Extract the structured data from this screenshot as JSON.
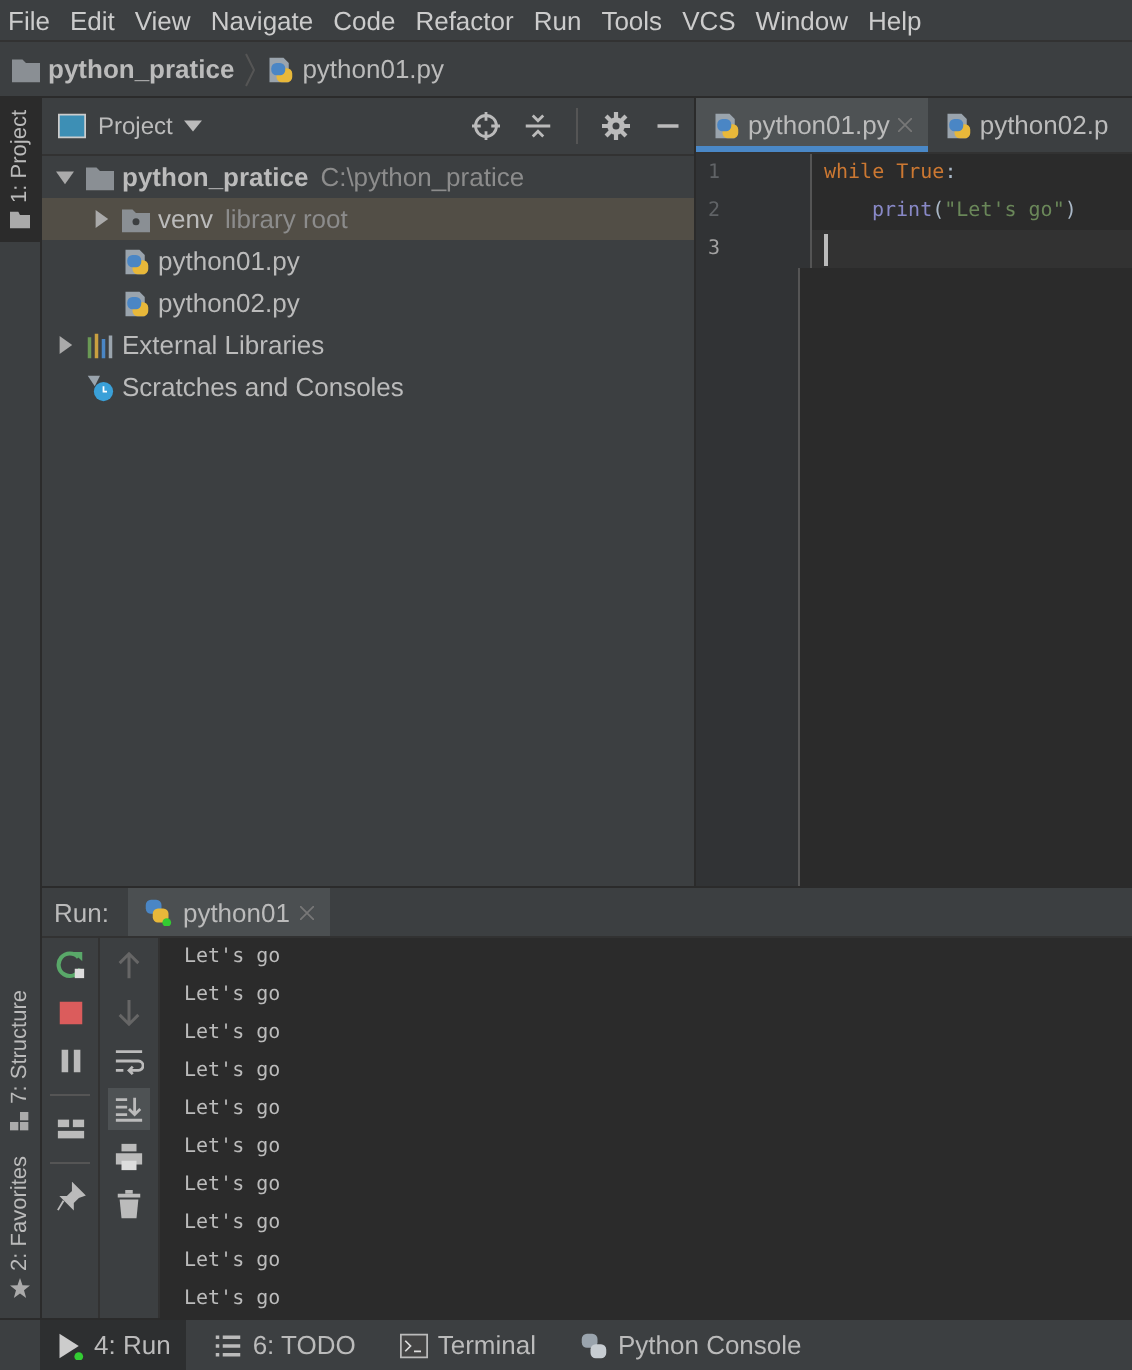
{
  "menu": [
    "File",
    "Edit",
    "View",
    "Navigate",
    "Code",
    "Refactor",
    "Run",
    "Tools",
    "VCS",
    "Window",
    "Help"
  ],
  "breadcrumb": [
    {
      "label": "python_pratice",
      "kind": "folder"
    },
    {
      "label": "python01.py",
      "kind": "python"
    }
  ],
  "side_tabs": [
    {
      "label": "1: Project",
      "selected": true,
      "kind": "project"
    },
    {
      "label": "7: Structure",
      "selected": false,
      "kind": "structure"
    },
    {
      "label": "2: Favorites",
      "selected": false,
      "kind": "favorites"
    }
  ],
  "project_panel": {
    "title": "Project",
    "tree": [
      {
        "name": "python_pratice",
        "hint": "C:\\python_pratice",
        "kind": "folder",
        "expanded": true,
        "children": [
          {
            "name": "venv",
            "hint": "library root",
            "kind": "venv",
            "expanded": false,
            "selected": true
          },
          {
            "name": "python01.py",
            "kind": "python",
            "selected": false
          },
          {
            "name": "python02.py",
            "kind": "python",
            "selected": false
          }
        ]
      },
      {
        "name": "External Libraries",
        "kind": "libraries",
        "expanded": false
      },
      {
        "name": "Scratches and Consoles",
        "kind": "scratches"
      }
    ]
  },
  "editor": {
    "tabs": [
      {
        "label": "python01.py",
        "selected": true
      },
      {
        "label": "python02.p",
        "selected": false
      }
    ],
    "lines": [
      {
        "number": "1",
        "current": false,
        "indent": false,
        "tokens": [
          {
            "kind": "keyword",
            "text": "while True"
          },
          {
            "kind": "plain",
            "text": ":"
          }
        ]
      },
      {
        "number": "2",
        "current": false,
        "indent": true,
        "tokens": [
          {
            "kind": "builtin",
            "text": "print"
          },
          {
            "kind": "plain",
            "text": "("
          },
          {
            "kind": "string",
            "text": "\"Let's go\""
          },
          {
            "kind": "plain",
            "text": ")"
          }
        ]
      },
      {
        "number": "3",
        "current": true,
        "indent": false
      }
    ]
  },
  "run_panel": {
    "title": "Run:",
    "tab": "python01",
    "output": [
      "Let's go",
      "Let's go",
      "Let's go",
      "Let's go",
      "Let's go",
      "Let's go",
      "Let's go",
      "Let's go",
      "Let's go",
      "Let's go"
    ]
  },
  "bottom_tabs": [
    {
      "label": "4: Run",
      "selected": true,
      "kind": "run"
    },
    {
      "label": "6: TODO",
      "selected": false,
      "kind": "todo"
    },
    {
      "label": "Terminal",
      "selected": false,
      "kind": "terminal"
    },
    {
      "label": "Python Console",
      "selected": false,
      "kind": "console"
    }
  ]
}
